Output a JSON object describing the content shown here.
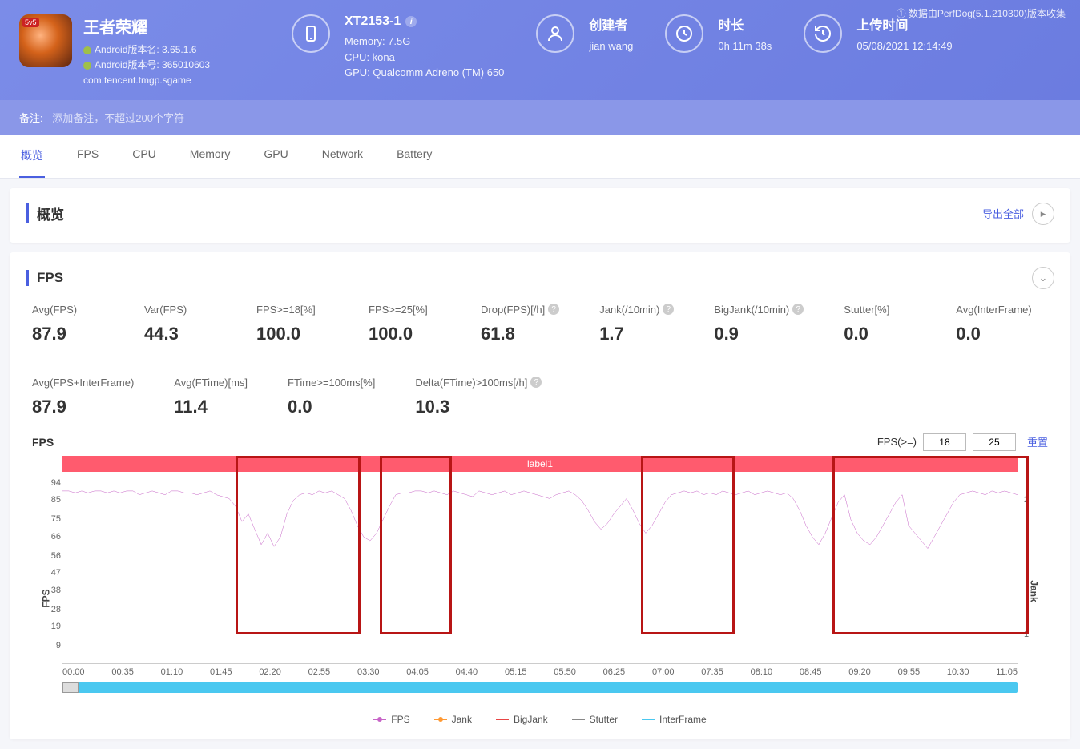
{
  "header": {
    "app_name": "王者荣耀",
    "android_version_name_label": "Android版本名: 3.65.1.6",
    "android_version_code_label": "Android版本号: 365010603",
    "package_name": "com.tencent.tmgp.sgame",
    "data_source": "① 数据由PerfDog(5.1.210300)版本收集"
  },
  "device": {
    "model": "XT2153-1",
    "memory": "Memory: 7.5G",
    "cpu": "CPU: kona",
    "gpu": "GPU: Qualcomm Adreno (TM) 650"
  },
  "creator": {
    "label": "创建者",
    "value": "jian wang"
  },
  "duration": {
    "label": "时长",
    "value": "0h 11m 38s"
  },
  "upload": {
    "label": "上传时间",
    "value": "05/08/2021 12:14:49"
  },
  "remark": {
    "label": "备注:",
    "placeholder": "添加备注，不超过200个字符"
  },
  "tabs": [
    "概览",
    "FPS",
    "CPU",
    "Memory",
    "GPU",
    "Network",
    "Battery"
  ],
  "overview": {
    "title": "概览",
    "export": "导出全部"
  },
  "fps": {
    "title": "FPS",
    "metrics": [
      {
        "label": "Avg(FPS)",
        "value": "87.9",
        "help": false
      },
      {
        "label": "Var(FPS)",
        "value": "44.3",
        "help": false
      },
      {
        "label": "FPS>=18[%]",
        "value": "100.0",
        "help": false
      },
      {
        "label": "FPS>=25[%]",
        "value": "100.0",
        "help": false
      },
      {
        "label": "Drop(FPS)[/h]",
        "value": "61.8",
        "help": true
      },
      {
        "label": "Jank(/10min)",
        "value": "1.7",
        "help": true
      },
      {
        "label": "BigJank(/10min)",
        "value": "0.9",
        "help": true
      },
      {
        "label": "Stutter[%]",
        "value": "0.0",
        "help": false
      },
      {
        "label": "Avg(InterFrame)",
        "value": "0.0",
        "help": false
      },
      {
        "label": "Avg(FPS+InterFrame)",
        "value": "87.9",
        "help": false
      },
      {
        "label": "Avg(FTime)[ms]",
        "value": "11.4",
        "help": false
      },
      {
        "label": "FTime>=100ms[%]",
        "value": "0.0",
        "help": false
      },
      {
        "label": "Delta(FTime)>100ms[/h]",
        "value": "10.3",
        "help": true
      }
    ],
    "chart_title": "FPS",
    "fps_ge_label": "FPS(>=)",
    "threshold1": "18",
    "threshold2": "25",
    "reset": "重置",
    "label_bar": "label1"
  },
  "chart_data": {
    "type": "line",
    "xlabel_left": "FPS",
    "xlabel_right": "Jank",
    "y_ticks": [
      9,
      19,
      28,
      38,
      47,
      56,
      66,
      75,
      85,
      94
    ],
    "y2_ticks": [
      1,
      2
    ],
    "x_ticks": [
      "00:00",
      "00:35",
      "01:10",
      "01:45",
      "02:20",
      "02:55",
      "03:30",
      "04:05",
      "04:40",
      "05:15",
      "05:50",
      "06:25",
      "07:00",
      "07:35",
      "08:10",
      "08:45",
      "09:20",
      "09:55",
      "10:30",
      "11:05"
    ],
    "ylim": [
      0,
      100
    ],
    "highlight_ranges_pct": [
      [
        18.1,
        31.2
      ],
      [
        33.2,
        40.8
      ],
      [
        60.6,
        70.4
      ],
      [
        80.6,
        101.2
      ]
    ],
    "series": [
      {
        "name": "FPS",
        "color": "#c764c7",
        "values": [
          90,
          90,
          89,
          90,
          89,
          90,
          90,
          89,
          90,
          89,
          90,
          90,
          88,
          89,
          90,
          89,
          88,
          90,
          90,
          89,
          89,
          88,
          89,
          90,
          88,
          87,
          86,
          82,
          74,
          78,
          70,
          62,
          68,
          61,
          66,
          78,
          85,
          88,
          89,
          88,
          90,
          89,
          90,
          88,
          86,
          80,
          72,
          66,
          64,
          68,
          75,
          82,
          88,
          89,
          89,
          90,
          90,
          89,
          90,
          89,
          88,
          90,
          89,
          88,
          87,
          90,
          89,
          88,
          89,
          90,
          88,
          89,
          90,
          89,
          88,
          87,
          86,
          88,
          89,
          90,
          88,
          85,
          80,
          74,
          70,
          73,
          78,
          82,
          86,
          80,
          73,
          68,
          72,
          78,
          84,
          88,
          89,
          90,
          89,
          90,
          88,
          89,
          88,
          90,
          89,
          88,
          89,
          90,
          88,
          89,
          90,
          89,
          88,
          89,
          86,
          80,
          72,
          66,
          62,
          68,
          76,
          84,
          88,
          75,
          68,
          64,
          62,
          66,
          72,
          78,
          84,
          88,
          72,
          68,
          64,
          60,
          66,
          72,
          78,
          84,
          88,
          89,
          90,
          89,
          88,
          90,
          89,
          90,
          89,
          88
        ]
      }
    ],
    "legend": [
      "FPS",
      "Jank",
      "BigJank",
      "Stutter",
      "InterFrame"
    ]
  }
}
